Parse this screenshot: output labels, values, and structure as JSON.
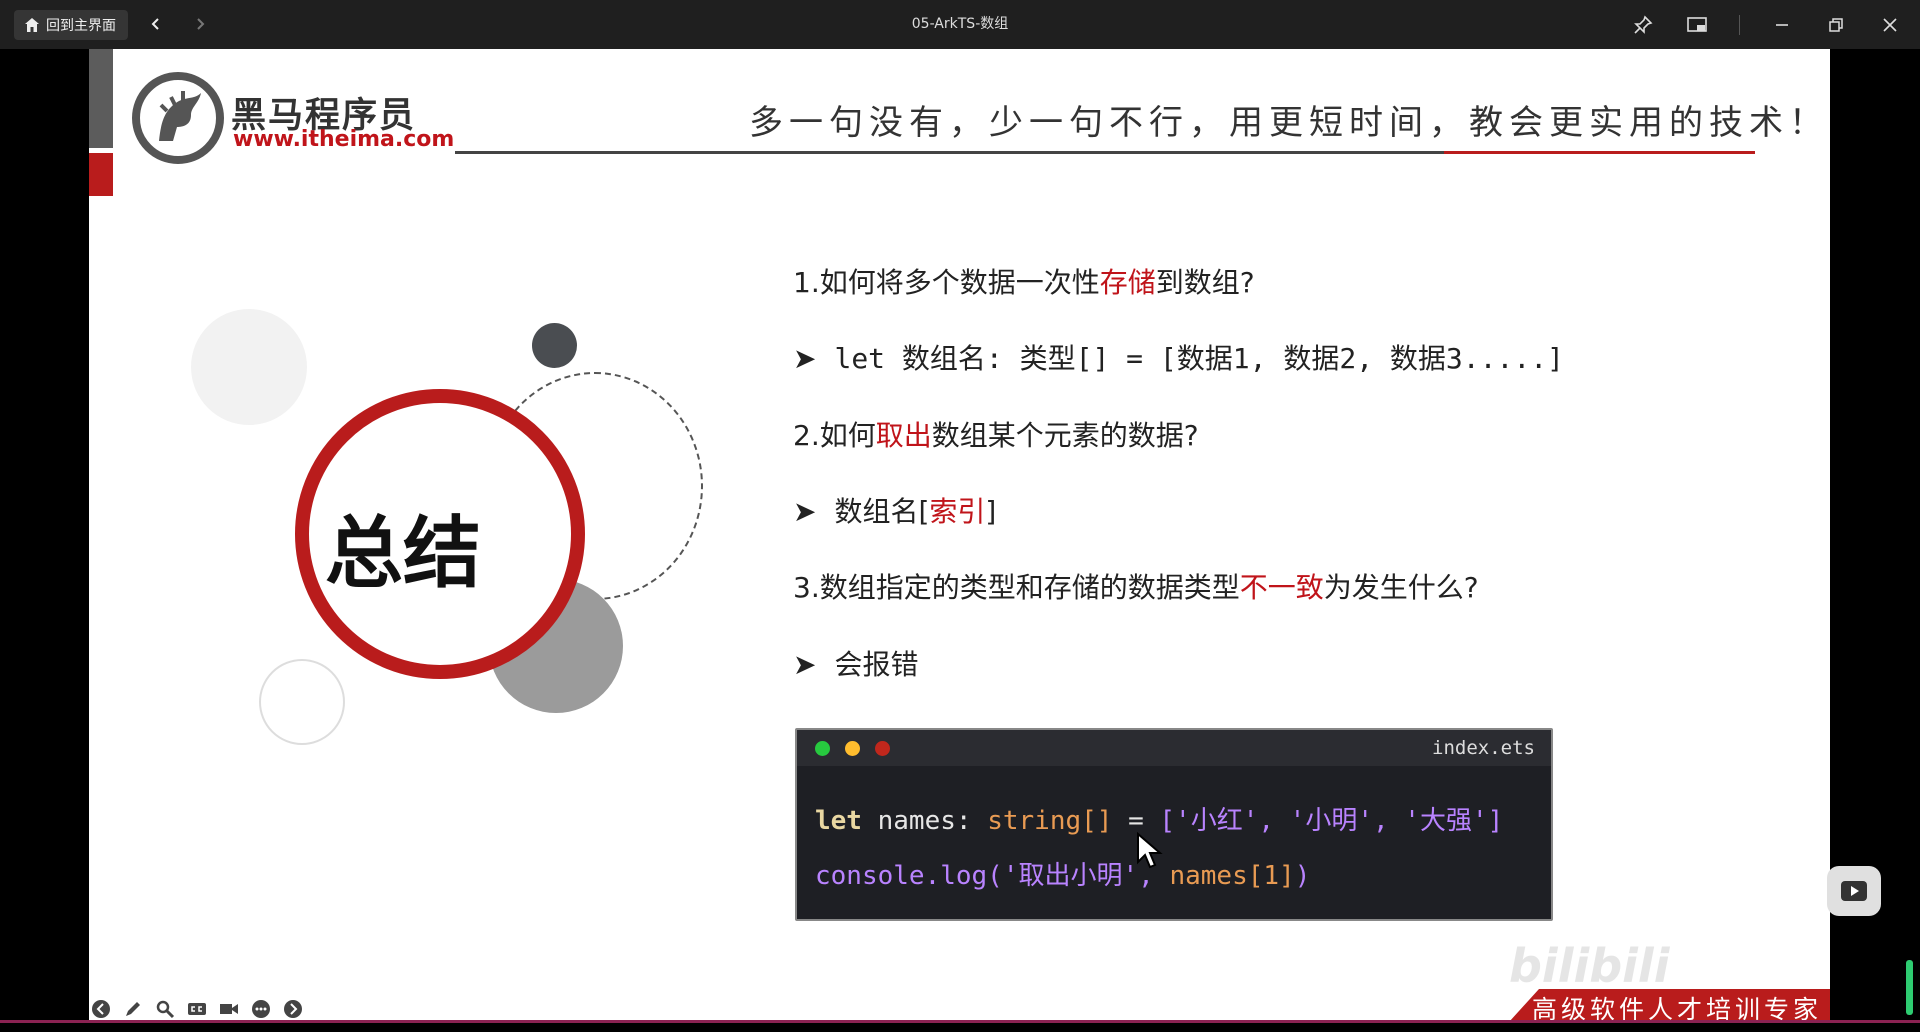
{
  "titlebar": {
    "home_label": "回到主界面",
    "window_title": "05-ArkTS-数组"
  },
  "slide": {
    "brand_name": "黑马程序员",
    "brand_url": "www.itheima.com",
    "slogan": "多一句没有，少一句不行，用更短时间，教会更实用的技术！",
    "summary_title": "总结",
    "q1": {
      "prefix": "1.如何将多个数据一次性",
      "highlight": "存储",
      "suffix": "到数组?"
    },
    "a1": {
      "arrow": "➤",
      "text": "let 数组名: 类型[] = [数据1, 数据2, 数据3.....]"
    },
    "q2": {
      "prefix": "2.如何",
      "highlight": "取出",
      "suffix": "数组某个元素的数据?"
    },
    "a2": {
      "arrow": "➤",
      "prefix": "数组名[",
      "highlight": "索引",
      "suffix": "]"
    },
    "q3": {
      "prefix": "3.数组指定的类型和存储的数据类型",
      "highlight": "不一致",
      "suffix": "为发生什么?"
    },
    "a3": {
      "arrow": "➤",
      "text": "会报错"
    },
    "code": {
      "file_name": "index.ets",
      "line1": {
        "kw": "let",
        "name": " names: ",
        "type": "string[]",
        "eq": " = ",
        "value": "['小红', '小明', '大强']"
      },
      "line2": {
        "call": "console.log('取出小明', ",
        "arg": "names[1]",
        "close": ")"
      }
    },
    "banner": "高级软件人才培训专家",
    "watermark": "bilibili"
  },
  "colors": {
    "accent_red": "#b91c1c",
    "code_bg": "#1e1f24",
    "mac_green": "#27c93f",
    "mac_yellow": "#ffbd2e",
    "mac_red": "#ff5f56"
  }
}
